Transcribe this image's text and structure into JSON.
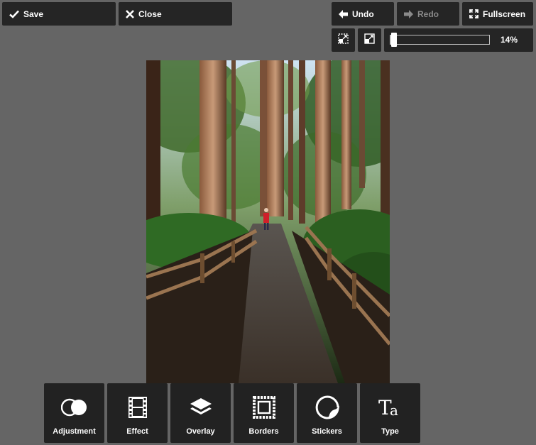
{
  "toolbar": {
    "save_label": "Save",
    "close_label": "Close",
    "undo_label": "Undo",
    "redo_label": "Redo",
    "redo_enabled": false,
    "fullscreen_label": "Fullscreen"
  },
  "zoom": {
    "value_label": "14%",
    "level": 0.14,
    "fit_icon": "zoom-fit-icon",
    "actual_size_icon": "zoom-actual-size-icon"
  },
  "photo": {
    "subject": "redwood-forest-trail-with-person-in-red-jacket"
  },
  "tools": [
    {
      "label": "Adjustment",
      "icon": "adjustment-icon"
    },
    {
      "label": "Effect",
      "icon": "film-strip-icon"
    },
    {
      "label": "Overlay",
      "icon": "layers-icon"
    },
    {
      "label": "Borders",
      "icon": "border-frame-icon"
    },
    {
      "label": "Stickers",
      "icon": "sticker-icon"
    },
    {
      "label": "Type",
      "icon": "type-icon"
    }
  ],
  "colors": {
    "background": "#656565",
    "button": "#252525",
    "text": "#ffffff",
    "disabled_text": "#8a8a8a"
  }
}
